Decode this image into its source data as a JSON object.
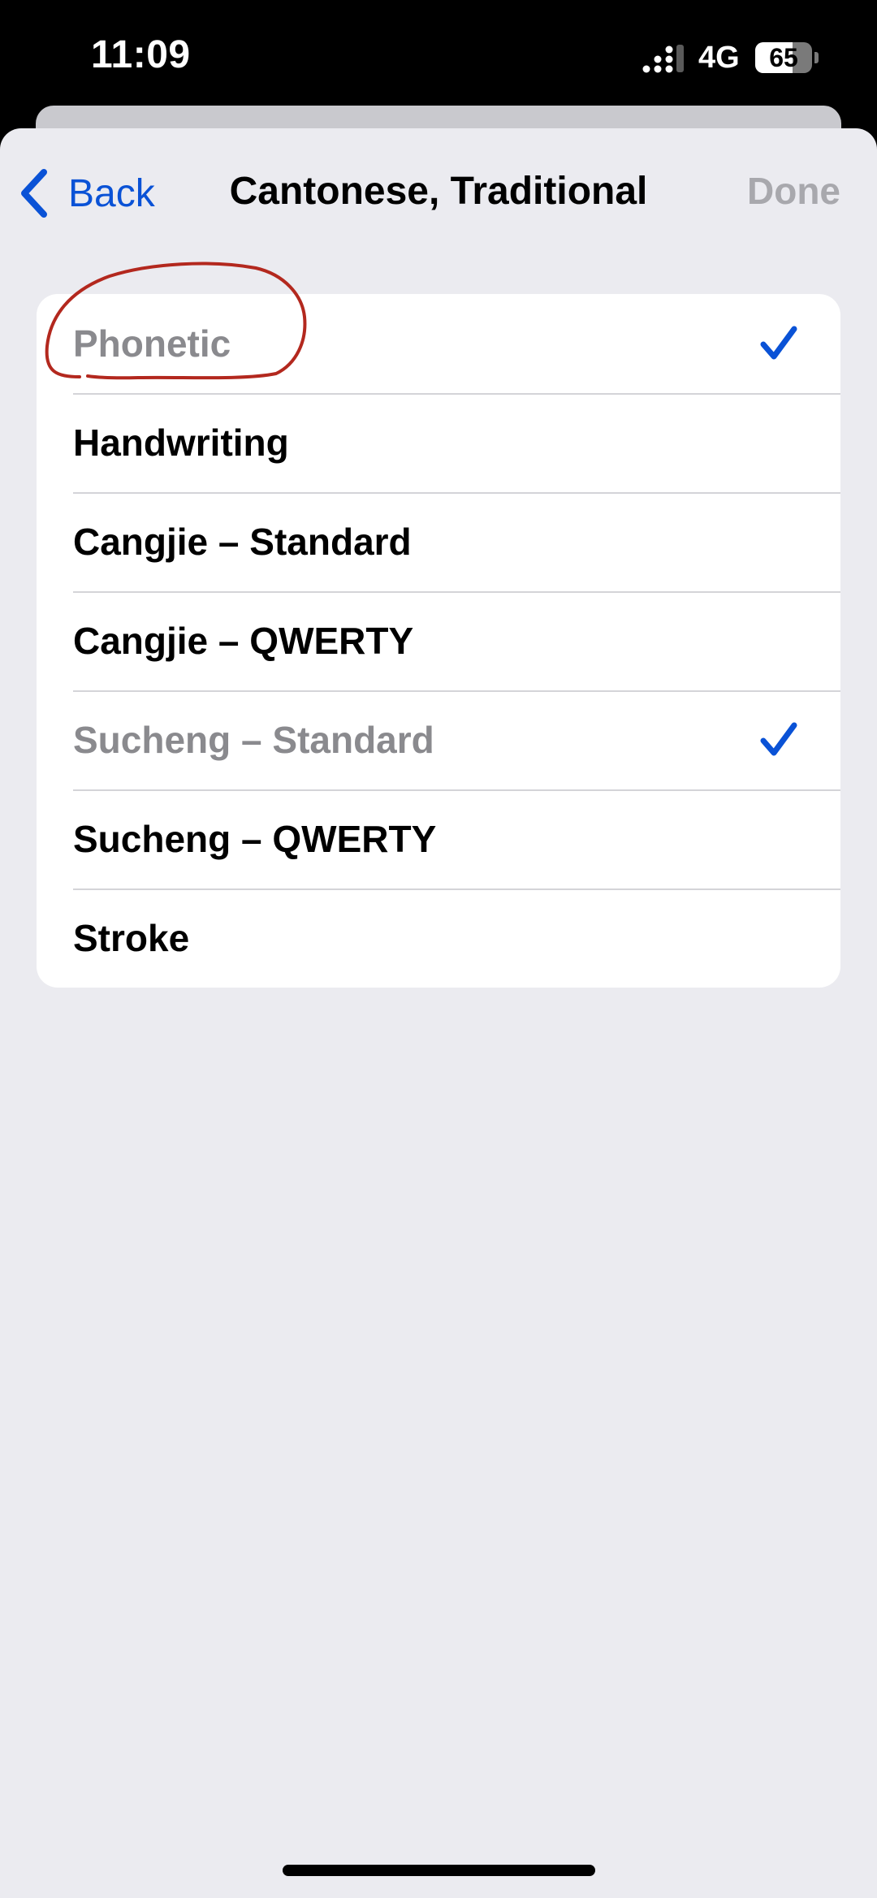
{
  "status_bar": {
    "time": "11:09",
    "network": "4G",
    "battery_percent": "65",
    "battery_level": 0.65
  },
  "nav": {
    "back_label": "Back",
    "title": "Cantonese, Traditional",
    "done_label": "Done"
  },
  "colors": {
    "accent": "#0a52d6",
    "annotation": "#b3281e",
    "selected_text": "#8a8a8e"
  },
  "input_methods": [
    {
      "label": "Phonetic",
      "checked": true
    },
    {
      "label": "Handwriting",
      "checked": false
    },
    {
      "label": "Cangjie – Standard",
      "checked": false
    },
    {
      "label": "Cangjie – QWERTY",
      "checked": false
    },
    {
      "label": "Sucheng – Standard",
      "checked": true
    },
    {
      "label": "Sucheng – QWERTY",
      "checked": false
    },
    {
      "label": "Stroke",
      "checked": false
    }
  ],
  "icons": {
    "back": "chevron-left-icon",
    "check": "checkmark-icon",
    "signal": "signal-bars-icon",
    "battery": "battery-icon"
  }
}
